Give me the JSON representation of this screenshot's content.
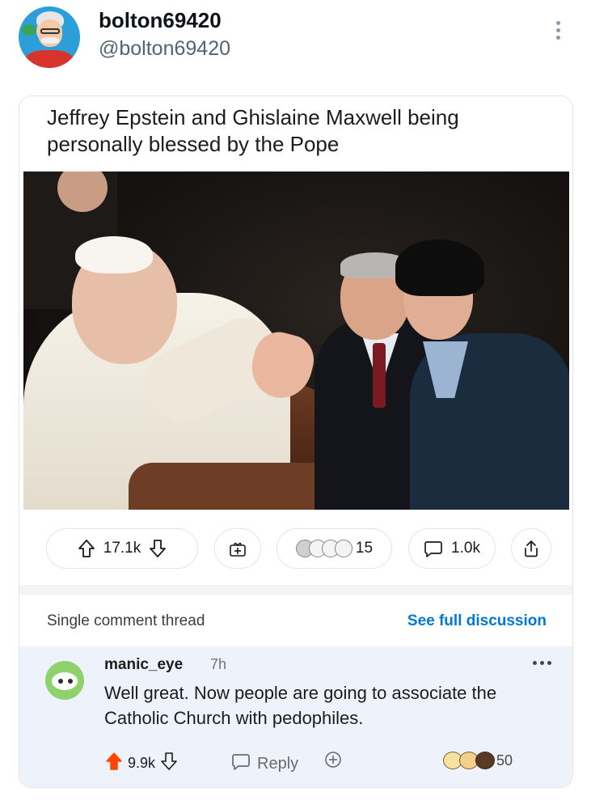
{
  "tweet": {
    "display_name": "bolton69420",
    "handle": "@bolton69420",
    "more_icon": "vertical-ellipsis-icon"
  },
  "post": {
    "title": "Jeffrey Epstein and Ghislaine Maxwell being personally blessed by the Pope",
    "upvotes": "17.1k",
    "awards_count": "15",
    "comments_count": "1.0k",
    "icons": {
      "upvote": "arrow-up-icon",
      "downvote": "arrow-down-icon",
      "award": "gift-icon",
      "comments": "comment-bubble-icon",
      "share": "share-icon"
    }
  },
  "thread": {
    "label": "Single comment thread",
    "see_full": "See full discussion"
  },
  "comment": {
    "username": "manic_eye",
    "age": "7h",
    "body": "Well great. Now people are going to associate the Catholic Church with pedophiles.",
    "upvotes": "9.9k",
    "reply_label": "Reply",
    "awards_count": "50"
  },
  "colors": {
    "reddit_orange": "#ff4500",
    "link_blue": "#0079d3",
    "comment_bg": "#eef3fb",
    "handle_gray": "#536471"
  }
}
